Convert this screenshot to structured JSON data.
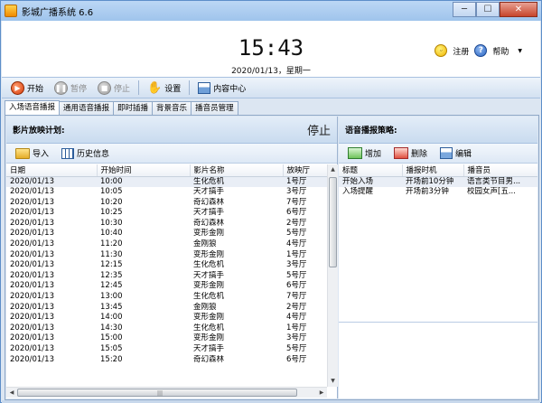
{
  "window": {
    "title": "影城广播系统 6.6",
    "minimize": "─",
    "maximize": "☐",
    "close": "✕"
  },
  "header": {
    "clock": "15:43",
    "date": "2020/01/13，星期一",
    "register": "注册",
    "help": "帮助",
    "help_caret": "▼"
  },
  "toolbar": {
    "start": "开始",
    "pause": "暂停",
    "stop": "停止",
    "settings": "设置",
    "content_center": "内容中心"
  },
  "tabs": [
    "入场语音播报",
    "通用语音播报",
    "即时插播",
    "背景音乐",
    "播音员管理"
  ],
  "schedule": {
    "title": "影片放映计划:",
    "status": "停止",
    "import": "导入",
    "history": "历史信息",
    "columns": [
      "日期",
      "开始时间",
      "影片名称",
      "放映厅"
    ],
    "rows": [
      [
        "2020/01/13",
        "10:00",
        "生化危机",
        "1号厅"
      ],
      [
        "2020/01/13",
        "10:05",
        "天才搞手",
        "3号厅"
      ],
      [
        "2020/01/13",
        "10:20",
        "奇幻森林",
        "7号厅"
      ],
      [
        "2020/01/13",
        "10:25",
        "天才搞手",
        "6号厅"
      ],
      [
        "2020/01/13",
        "10:30",
        "奇幻森林",
        "2号厅"
      ],
      [
        "2020/01/13",
        "10:40",
        "变形金刚",
        "5号厅"
      ],
      [
        "2020/01/13",
        "11:20",
        "金刚狼",
        "4号厅"
      ],
      [
        "2020/01/13",
        "11:30",
        "变形金刚",
        "1号厅"
      ],
      [
        "2020/01/13",
        "12:15",
        "生化危机",
        "3号厅"
      ],
      [
        "2020/01/13",
        "12:35",
        "天才搞手",
        "5号厅"
      ],
      [
        "2020/01/13",
        "12:45",
        "变形金刚",
        "6号厅"
      ],
      [
        "2020/01/13",
        "13:00",
        "生化危机",
        "7号厅"
      ],
      [
        "2020/01/13",
        "13:45",
        "金刚狼",
        "2号厅"
      ],
      [
        "2020/01/13",
        "14:00",
        "变形金刚",
        "4号厅"
      ],
      [
        "2020/01/13",
        "14:30",
        "生化危机",
        "1号厅"
      ],
      [
        "2020/01/13",
        "15:00",
        "变形金刚",
        "3号厅"
      ],
      [
        "2020/01/13",
        "15:05",
        "天才搞手",
        "5号厅"
      ],
      [
        "2020/01/13",
        "15:20",
        "奇幻森林",
        "6号厅"
      ]
    ]
  },
  "strategy": {
    "title": "语音播报策略:",
    "add": "增加",
    "delete": "删除",
    "edit": "编辑",
    "columns": [
      "标题",
      "播报时机",
      "播音员"
    ],
    "rows": [
      [
        "开始入场",
        "开场前10分钟",
        "语言类节目男..."
      ],
      [
        "入场提醒",
        "开场前3分钟",
        "校园女声[五..."
      ]
    ]
  }
}
